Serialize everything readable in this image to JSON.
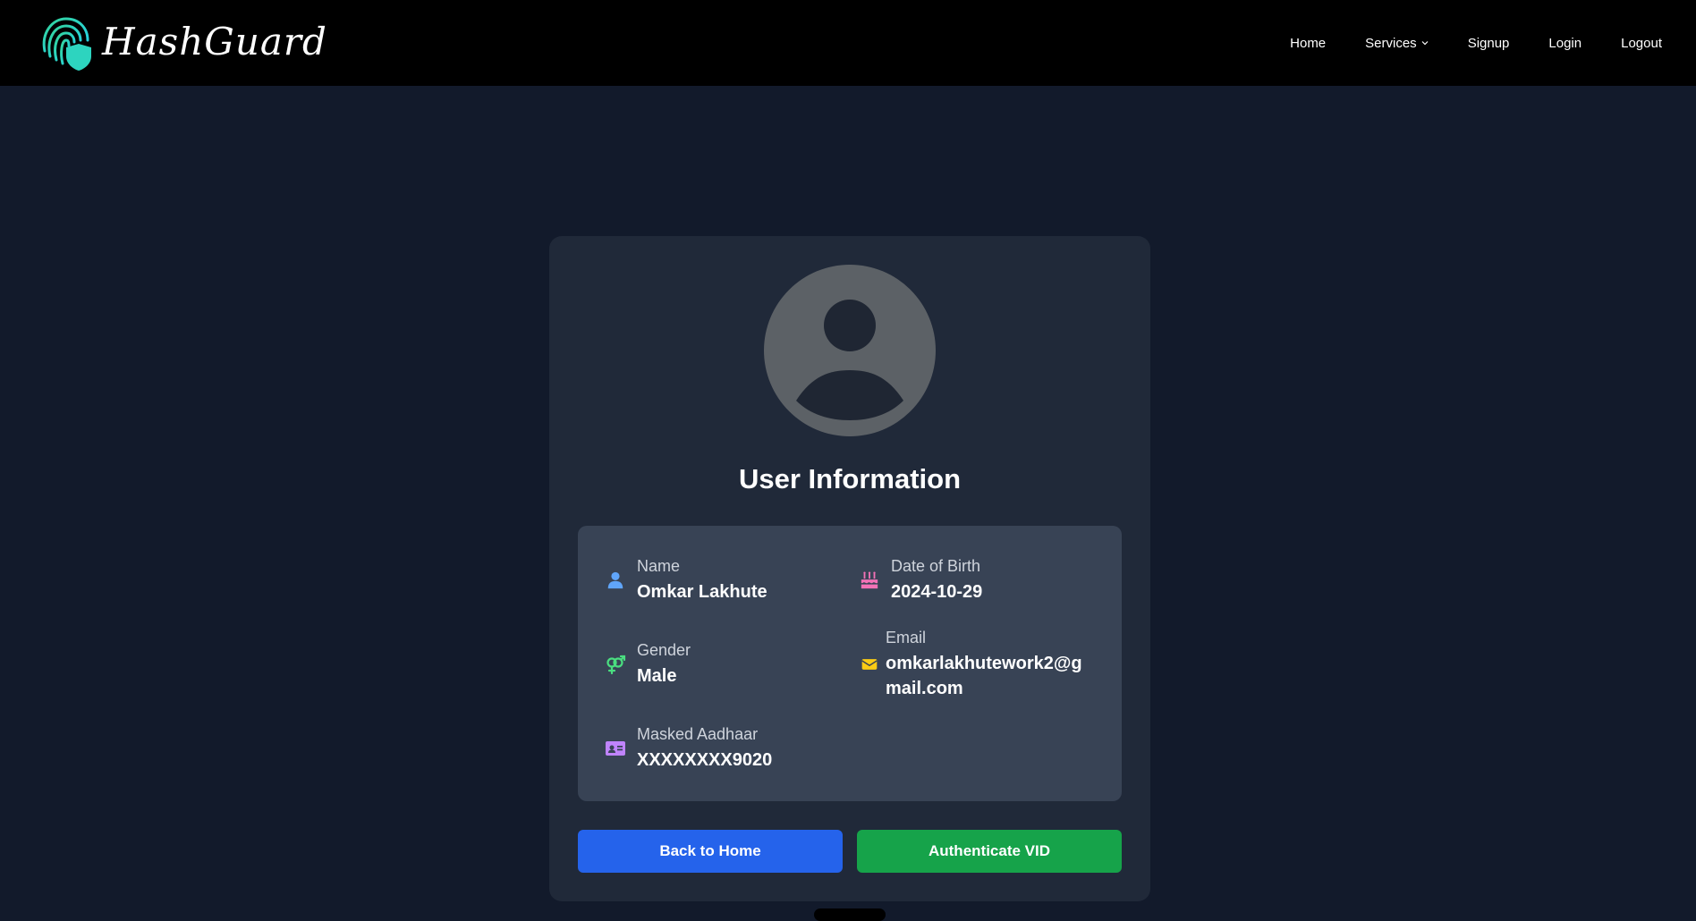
{
  "header": {
    "brand": "HashGuard",
    "nav": [
      {
        "label": "Home"
      },
      {
        "label": "Services"
      },
      {
        "label": "Signup"
      },
      {
        "label": "Login"
      },
      {
        "label": "Logout"
      }
    ]
  },
  "card": {
    "title": "User Information",
    "fields": {
      "name": {
        "label": "Name",
        "value": "Omkar Lakhute",
        "icon": "user-icon"
      },
      "dob": {
        "label": "Date of Birth",
        "value": "2024-10-29",
        "icon": "birthday-cake-icon"
      },
      "gender": {
        "label": "Gender",
        "value": "Male",
        "icon": "gender-icon"
      },
      "email": {
        "label": "Email",
        "value": "omkarlakhutework2@gmail.com",
        "icon": "envelope-icon"
      },
      "aadhaar": {
        "label": "Masked Aadhaar",
        "value": "XXXXXXXX9020",
        "icon": "id-card-icon"
      }
    },
    "buttons": {
      "back": "Back to Home",
      "authenticate": "Authenticate VID"
    }
  },
  "colors": {
    "navbar_bg": "#000000",
    "page_bg": "#121a2b",
    "card_bg": "#202939",
    "panel_bg": "#384355",
    "primary": "#2563eb",
    "success": "#16a34a",
    "logo_accent": "#2dd4bf"
  }
}
